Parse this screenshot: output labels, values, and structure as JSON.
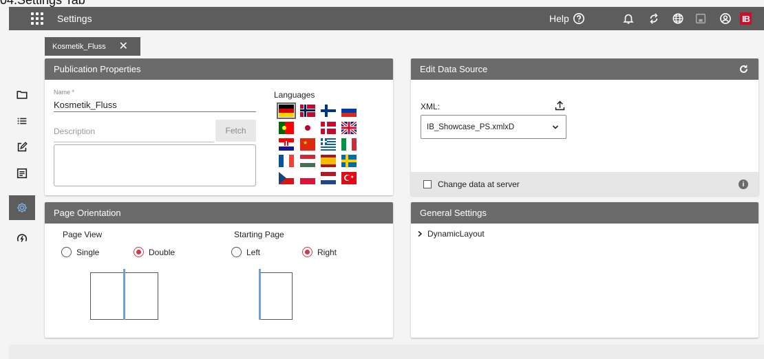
{
  "caption": "04.Settings Tab",
  "topbar": {
    "title": "Settings",
    "help_label": "Help",
    "icons": [
      "apps-icon",
      "help-circle-icon",
      "bell-icon",
      "sync-icon",
      "globe-icon",
      "save-icon",
      "account-icon",
      "brand-logo"
    ],
    "brand_text": "IB"
  },
  "sidebar": {
    "items": [
      "folder-icon",
      "list-icon",
      "edit-icon",
      "document-icon",
      "settings-icon",
      "dashboard-icon"
    ],
    "active": "settings-icon"
  },
  "tab": {
    "label": "Kosmetik_Fluss",
    "close": "✕"
  },
  "publication": {
    "title": "Publication Properties",
    "name_label": "Name *",
    "name_value": "Kosmetik_Fluss",
    "description_placeholder": "Description",
    "fetch_label": "Fetch",
    "languages_label": "Languages",
    "flags": [
      "de",
      "no",
      "fi",
      "ru",
      "pt",
      "jp",
      "dk",
      "gb",
      "hr",
      "cn",
      "gr",
      "it",
      "fr",
      "hu",
      "es",
      "se",
      "cz",
      "pl",
      "nl",
      "tr"
    ],
    "selected_flag": "de"
  },
  "orientation": {
    "title": "Page Orientation",
    "page_view_label": "Page View",
    "single_label": "Single",
    "double_label": "Double",
    "page_view_selected": "Double",
    "starting_page_label": "Starting Page",
    "left_label": "Left",
    "right_label": "Right",
    "starting_page_selected": "Right"
  },
  "data_source": {
    "title": "Edit Data Source",
    "xml_label": "XML:",
    "xml_value": "IB_Showcase_PS.xmlxD",
    "change_label": "Change data at server",
    "info_glyph": "i"
  },
  "general": {
    "title": "General Settings",
    "tree_item": "DynamicLayout",
    "chevron": "›"
  },
  "colors": {
    "header": "#6b6b6b",
    "topbar": "#5d5d5d",
    "accent": "#d1344b",
    "spine": "#6ea0d8",
    "brand": "#c8102e"
  }
}
